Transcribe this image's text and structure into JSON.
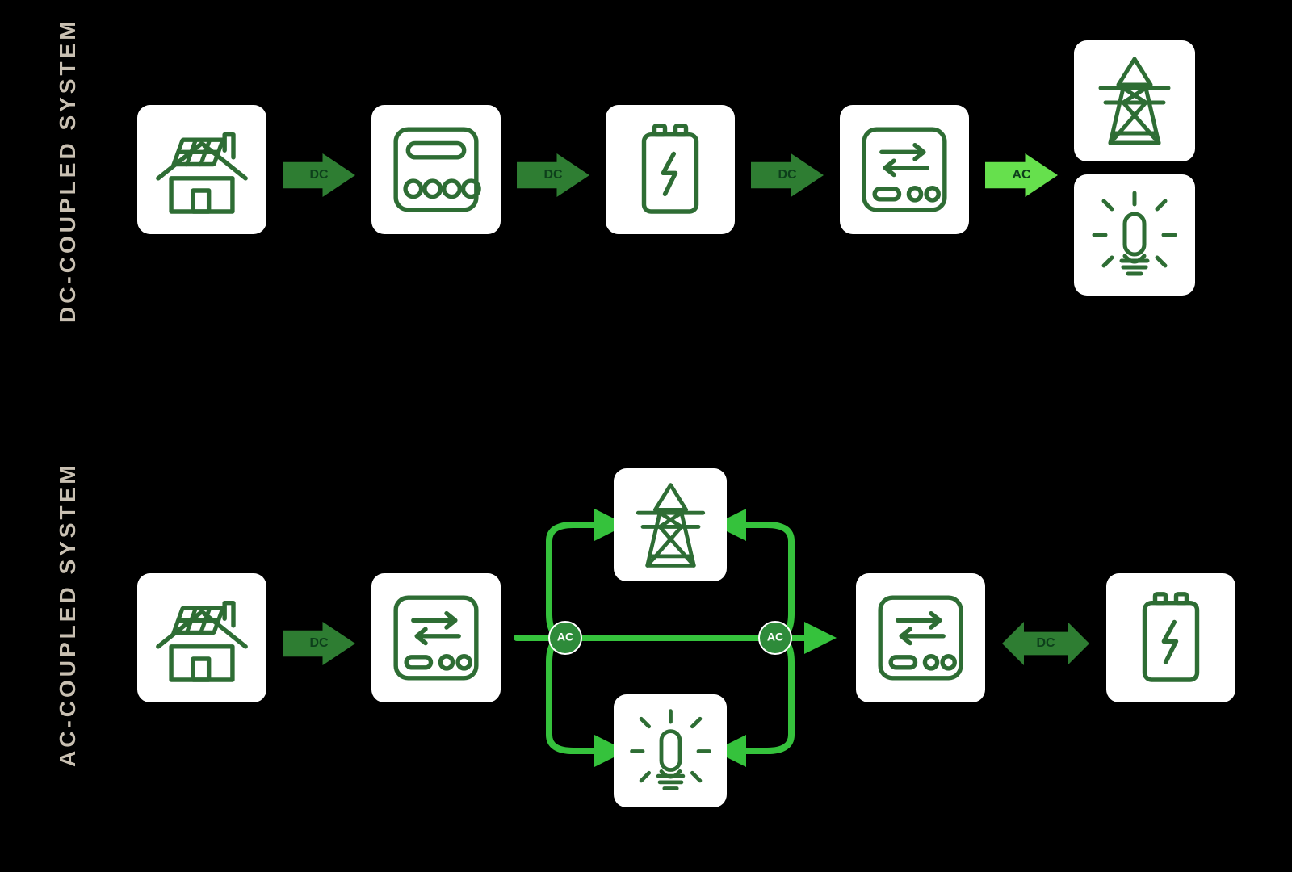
{
  "colors": {
    "bg": "#000000",
    "card_bg": "#ffffff",
    "stroke": "#2e6d34",
    "arrow_dark": "#2e7d32",
    "arrow_mid": "#49b33d",
    "arrow_light": "#66e04d",
    "title": "#c9c0b2",
    "loop": "#35c23c"
  },
  "dc_system": {
    "title": "DC-Coupled System",
    "nodes": [
      {
        "id": "solar-house",
        "label": "Solar panels / home",
        "icon": "house-solar"
      },
      {
        "id": "charge-controller",
        "label": "Charge controller",
        "icon": "controller"
      },
      {
        "id": "battery",
        "label": "Battery",
        "icon": "battery"
      },
      {
        "id": "inverter",
        "label": "Inverter",
        "icon": "inverter"
      },
      {
        "id": "grid",
        "label": "Utility grid",
        "icon": "grid-tower"
      },
      {
        "id": "load",
        "label": "Home load",
        "icon": "bulb"
      }
    ],
    "flows": [
      {
        "from": "solar-house",
        "to": "charge-controller",
        "label": "DC",
        "color": "arrow_dark"
      },
      {
        "from": "charge-controller",
        "to": "battery",
        "label": "DC",
        "color": "arrow_dark"
      },
      {
        "from": "battery",
        "to": "inverter",
        "label": "DC",
        "color": "arrow_dark"
      },
      {
        "from": "inverter",
        "to": "grid/load",
        "label": "AC",
        "color": "arrow_light"
      }
    ]
  },
  "ac_system": {
    "title": "AC-Coupled System",
    "nodes": [
      {
        "id": "solar-house",
        "label": "Solar panels / home",
        "icon": "house-solar"
      },
      {
        "id": "pv-inverter",
        "label": "PV inverter",
        "icon": "inverter"
      },
      {
        "id": "grid",
        "label": "Utility grid",
        "icon": "grid-tower"
      },
      {
        "id": "load",
        "label": "Home load",
        "icon": "bulb"
      },
      {
        "id": "battery-inverter",
        "label": "Battery inverter",
        "icon": "inverter"
      },
      {
        "id": "battery",
        "label": "Battery",
        "icon": "battery"
      }
    ],
    "flows": [
      {
        "from": "solar-house",
        "to": "pv-inverter",
        "label": "DC",
        "color": "arrow_dark",
        "bidirectional": false
      },
      {
        "from": "pv-inverter",
        "to": "ac-bus",
        "label": "AC",
        "color": "loop",
        "hub": true
      },
      {
        "from": "ac-bus",
        "to": "grid",
        "label": "AC",
        "color": "loop"
      },
      {
        "from": "ac-bus",
        "to": "load",
        "label": "AC",
        "color": "loop"
      },
      {
        "from": "ac-bus",
        "to": "battery-inverter",
        "label": "AC",
        "color": "loop",
        "hub": true
      },
      {
        "from": "battery-inverter",
        "to": "battery",
        "label": "DC",
        "color": "arrow_dark",
        "bidirectional": true
      }
    ],
    "ac_bus_nodes": [
      "AC",
      "AC"
    ]
  }
}
